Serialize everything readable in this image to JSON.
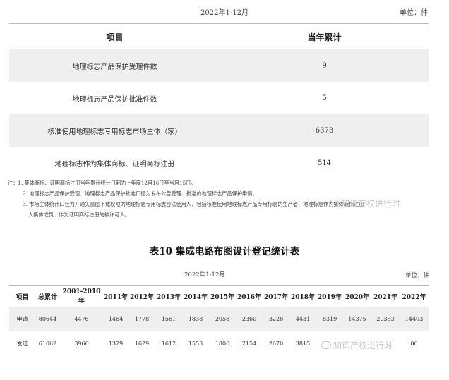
{
  "top_header": {
    "period": "2022年1-12月",
    "unit": "单位：件"
  },
  "table1": {
    "headers": [
      "项目",
      "当年累计"
    ],
    "rows": [
      {
        "label": "地理标志产品保护受理件数",
        "value": "9"
      },
      {
        "label": "地理标志产品保护批准件数",
        "value": "5"
      },
      {
        "label": "核准使用地理标志专用标志市场主体（家）",
        "value": "6373"
      },
      {
        "label": "地理标志作为集体商标、证明商标注册",
        "value": "514"
      }
    ]
  },
  "notes": [
    "注：1. 集体商标、证明商标注册当年累计统计日期为上年度12月16日至当月15日。",
    "2. 地理标志产品保护受理、地理标志产品保护批准口径为发布公告受理、批准的地理标志产品保护申请。",
    "3. 市场主体统计口径为开通矢量图下载权限的地理标志专用标志合法使用人，包括核准使用地理标志产品专用标志的生产者、地理标志作为集体商标注册",
    "人集体成员、作为证明商标注册的被许可人。"
  ],
  "table2": {
    "title": "表10 集成电路布图设计登记统计表",
    "period": "2022年1-12月",
    "unit": "单位：件",
    "headers": [
      "项目",
      "总累计",
      "2001-2010年",
      "2011年",
      "2012年",
      "2013年",
      "2014年",
      "2015年",
      "2016年",
      "2017年",
      "2018年",
      "2019年",
      "2020年",
      "2021年",
      "2022年"
    ],
    "rows": [
      {
        "cells": [
          "申请",
          "80644",
          "4476",
          "1464",
          "1778",
          "1561",
          "1838",
          "2058",
          "2360",
          "3228",
          "4431",
          "8319",
          "14375",
          "20353",
          "14403"
        ]
      },
      {
        "cells": [
          "发证",
          "61062",
          "3966",
          "1329",
          "1629",
          "1612",
          "1553",
          "1800",
          "2154",
          "2670",
          "3815",
          "",
          "",
          "",
          "06"
        ]
      }
    ]
  },
  "watermark": {
    "text": "知识产权进行时"
  }
}
